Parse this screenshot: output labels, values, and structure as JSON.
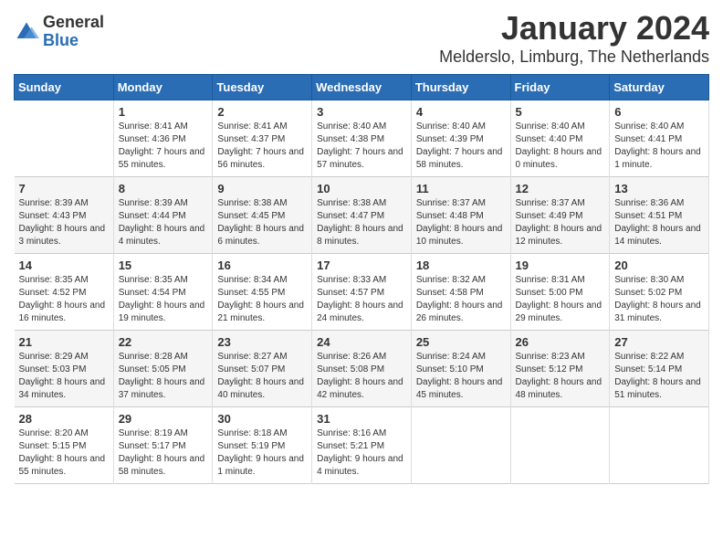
{
  "logo": {
    "general": "General",
    "blue": "Blue"
  },
  "title": "January 2024",
  "location": "Melderslo, Limburg, The Netherlands",
  "days_of_week": [
    "Sunday",
    "Monday",
    "Tuesday",
    "Wednesday",
    "Thursday",
    "Friday",
    "Saturday"
  ],
  "weeks": [
    [
      {
        "day": "",
        "sunrise": "",
        "sunset": "",
        "daylight": ""
      },
      {
        "day": "1",
        "sunrise": "Sunrise: 8:41 AM",
        "sunset": "Sunset: 4:36 PM",
        "daylight": "Daylight: 7 hours and 55 minutes."
      },
      {
        "day": "2",
        "sunrise": "Sunrise: 8:41 AM",
        "sunset": "Sunset: 4:37 PM",
        "daylight": "Daylight: 7 hours and 56 minutes."
      },
      {
        "day": "3",
        "sunrise": "Sunrise: 8:40 AM",
        "sunset": "Sunset: 4:38 PM",
        "daylight": "Daylight: 7 hours and 57 minutes."
      },
      {
        "day": "4",
        "sunrise": "Sunrise: 8:40 AM",
        "sunset": "Sunset: 4:39 PM",
        "daylight": "Daylight: 7 hours and 58 minutes."
      },
      {
        "day": "5",
        "sunrise": "Sunrise: 8:40 AM",
        "sunset": "Sunset: 4:40 PM",
        "daylight": "Daylight: 8 hours and 0 minutes."
      },
      {
        "day": "6",
        "sunrise": "Sunrise: 8:40 AM",
        "sunset": "Sunset: 4:41 PM",
        "daylight": "Daylight: 8 hours and 1 minute."
      }
    ],
    [
      {
        "day": "7",
        "sunrise": "Sunrise: 8:39 AM",
        "sunset": "Sunset: 4:43 PM",
        "daylight": "Daylight: 8 hours and 3 minutes."
      },
      {
        "day": "8",
        "sunrise": "Sunrise: 8:39 AM",
        "sunset": "Sunset: 4:44 PM",
        "daylight": "Daylight: 8 hours and 4 minutes."
      },
      {
        "day": "9",
        "sunrise": "Sunrise: 8:38 AM",
        "sunset": "Sunset: 4:45 PM",
        "daylight": "Daylight: 8 hours and 6 minutes."
      },
      {
        "day": "10",
        "sunrise": "Sunrise: 8:38 AM",
        "sunset": "Sunset: 4:47 PM",
        "daylight": "Daylight: 8 hours and 8 minutes."
      },
      {
        "day": "11",
        "sunrise": "Sunrise: 8:37 AM",
        "sunset": "Sunset: 4:48 PM",
        "daylight": "Daylight: 8 hours and 10 minutes."
      },
      {
        "day": "12",
        "sunrise": "Sunrise: 8:37 AM",
        "sunset": "Sunset: 4:49 PM",
        "daylight": "Daylight: 8 hours and 12 minutes."
      },
      {
        "day": "13",
        "sunrise": "Sunrise: 8:36 AM",
        "sunset": "Sunset: 4:51 PM",
        "daylight": "Daylight: 8 hours and 14 minutes."
      }
    ],
    [
      {
        "day": "14",
        "sunrise": "Sunrise: 8:35 AM",
        "sunset": "Sunset: 4:52 PM",
        "daylight": "Daylight: 8 hours and 16 minutes."
      },
      {
        "day": "15",
        "sunrise": "Sunrise: 8:35 AM",
        "sunset": "Sunset: 4:54 PM",
        "daylight": "Daylight: 8 hours and 19 minutes."
      },
      {
        "day": "16",
        "sunrise": "Sunrise: 8:34 AM",
        "sunset": "Sunset: 4:55 PM",
        "daylight": "Daylight: 8 hours and 21 minutes."
      },
      {
        "day": "17",
        "sunrise": "Sunrise: 8:33 AM",
        "sunset": "Sunset: 4:57 PM",
        "daylight": "Daylight: 8 hours and 24 minutes."
      },
      {
        "day": "18",
        "sunrise": "Sunrise: 8:32 AM",
        "sunset": "Sunset: 4:58 PM",
        "daylight": "Daylight: 8 hours and 26 minutes."
      },
      {
        "day": "19",
        "sunrise": "Sunrise: 8:31 AM",
        "sunset": "Sunset: 5:00 PM",
        "daylight": "Daylight: 8 hours and 29 minutes."
      },
      {
        "day": "20",
        "sunrise": "Sunrise: 8:30 AM",
        "sunset": "Sunset: 5:02 PM",
        "daylight": "Daylight: 8 hours and 31 minutes."
      }
    ],
    [
      {
        "day": "21",
        "sunrise": "Sunrise: 8:29 AM",
        "sunset": "Sunset: 5:03 PM",
        "daylight": "Daylight: 8 hours and 34 minutes."
      },
      {
        "day": "22",
        "sunrise": "Sunrise: 8:28 AM",
        "sunset": "Sunset: 5:05 PM",
        "daylight": "Daylight: 8 hours and 37 minutes."
      },
      {
        "day": "23",
        "sunrise": "Sunrise: 8:27 AM",
        "sunset": "Sunset: 5:07 PM",
        "daylight": "Daylight: 8 hours and 40 minutes."
      },
      {
        "day": "24",
        "sunrise": "Sunrise: 8:26 AM",
        "sunset": "Sunset: 5:08 PM",
        "daylight": "Daylight: 8 hours and 42 minutes."
      },
      {
        "day": "25",
        "sunrise": "Sunrise: 8:24 AM",
        "sunset": "Sunset: 5:10 PM",
        "daylight": "Daylight: 8 hours and 45 minutes."
      },
      {
        "day": "26",
        "sunrise": "Sunrise: 8:23 AM",
        "sunset": "Sunset: 5:12 PM",
        "daylight": "Daylight: 8 hours and 48 minutes."
      },
      {
        "day": "27",
        "sunrise": "Sunrise: 8:22 AM",
        "sunset": "Sunset: 5:14 PM",
        "daylight": "Daylight: 8 hours and 51 minutes."
      }
    ],
    [
      {
        "day": "28",
        "sunrise": "Sunrise: 8:20 AM",
        "sunset": "Sunset: 5:15 PM",
        "daylight": "Daylight: 8 hours and 55 minutes."
      },
      {
        "day": "29",
        "sunrise": "Sunrise: 8:19 AM",
        "sunset": "Sunset: 5:17 PM",
        "daylight": "Daylight: 8 hours and 58 minutes."
      },
      {
        "day": "30",
        "sunrise": "Sunrise: 8:18 AM",
        "sunset": "Sunset: 5:19 PM",
        "daylight": "Daylight: 9 hours and 1 minute."
      },
      {
        "day": "31",
        "sunrise": "Sunrise: 8:16 AM",
        "sunset": "Sunset: 5:21 PM",
        "daylight": "Daylight: 9 hours and 4 minutes."
      },
      {
        "day": "",
        "sunrise": "",
        "sunset": "",
        "daylight": ""
      },
      {
        "day": "",
        "sunrise": "",
        "sunset": "",
        "daylight": ""
      },
      {
        "day": "",
        "sunrise": "",
        "sunset": "",
        "daylight": ""
      }
    ]
  ]
}
